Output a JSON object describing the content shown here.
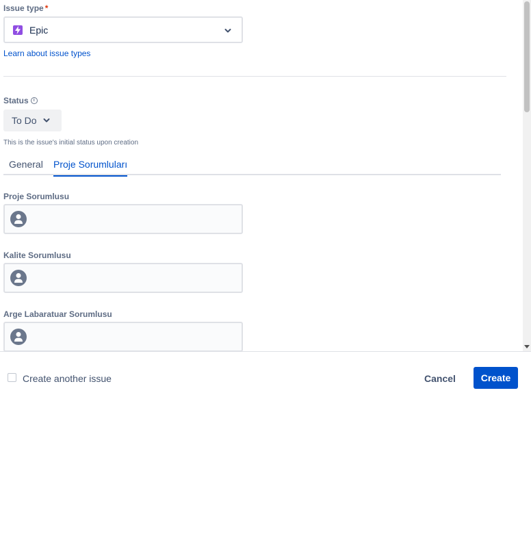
{
  "issue_type": {
    "label": "Issue type",
    "required_mark": "*",
    "value": "Epic",
    "icon": "epic-lightning-icon",
    "icon_color": "#904ee2",
    "learn_link": "Learn about issue types"
  },
  "status": {
    "label": "Status",
    "info_icon": "i",
    "value": "To Do",
    "help_text": "This is the issue's initial status upon creation"
  },
  "tabs": [
    {
      "label": "General",
      "active": false
    },
    {
      "label": "Proje Sorumluları",
      "active": true
    }
  ],
  "user_fields": [
    {
      "label": "Proje Sorumlusu",
      "value": ""
    },
    {
      "label": "Kalite Sorumlusu",
      "value": ""
    },
    {
      "label": "Arge Labaratuar Sorumlusu",
      "value": ""
    }
  ],
  "footer": {
    "create_another_label": "Create another issue",
    "create_another_checked": false,
    "cancel_label": "Cancel",
    "create_label": "Create"
  },
  "colors": {
    "primary": "#0052cc",
    "text": "#172b4d",
    "muted": "#5e6c84"
  }
}
